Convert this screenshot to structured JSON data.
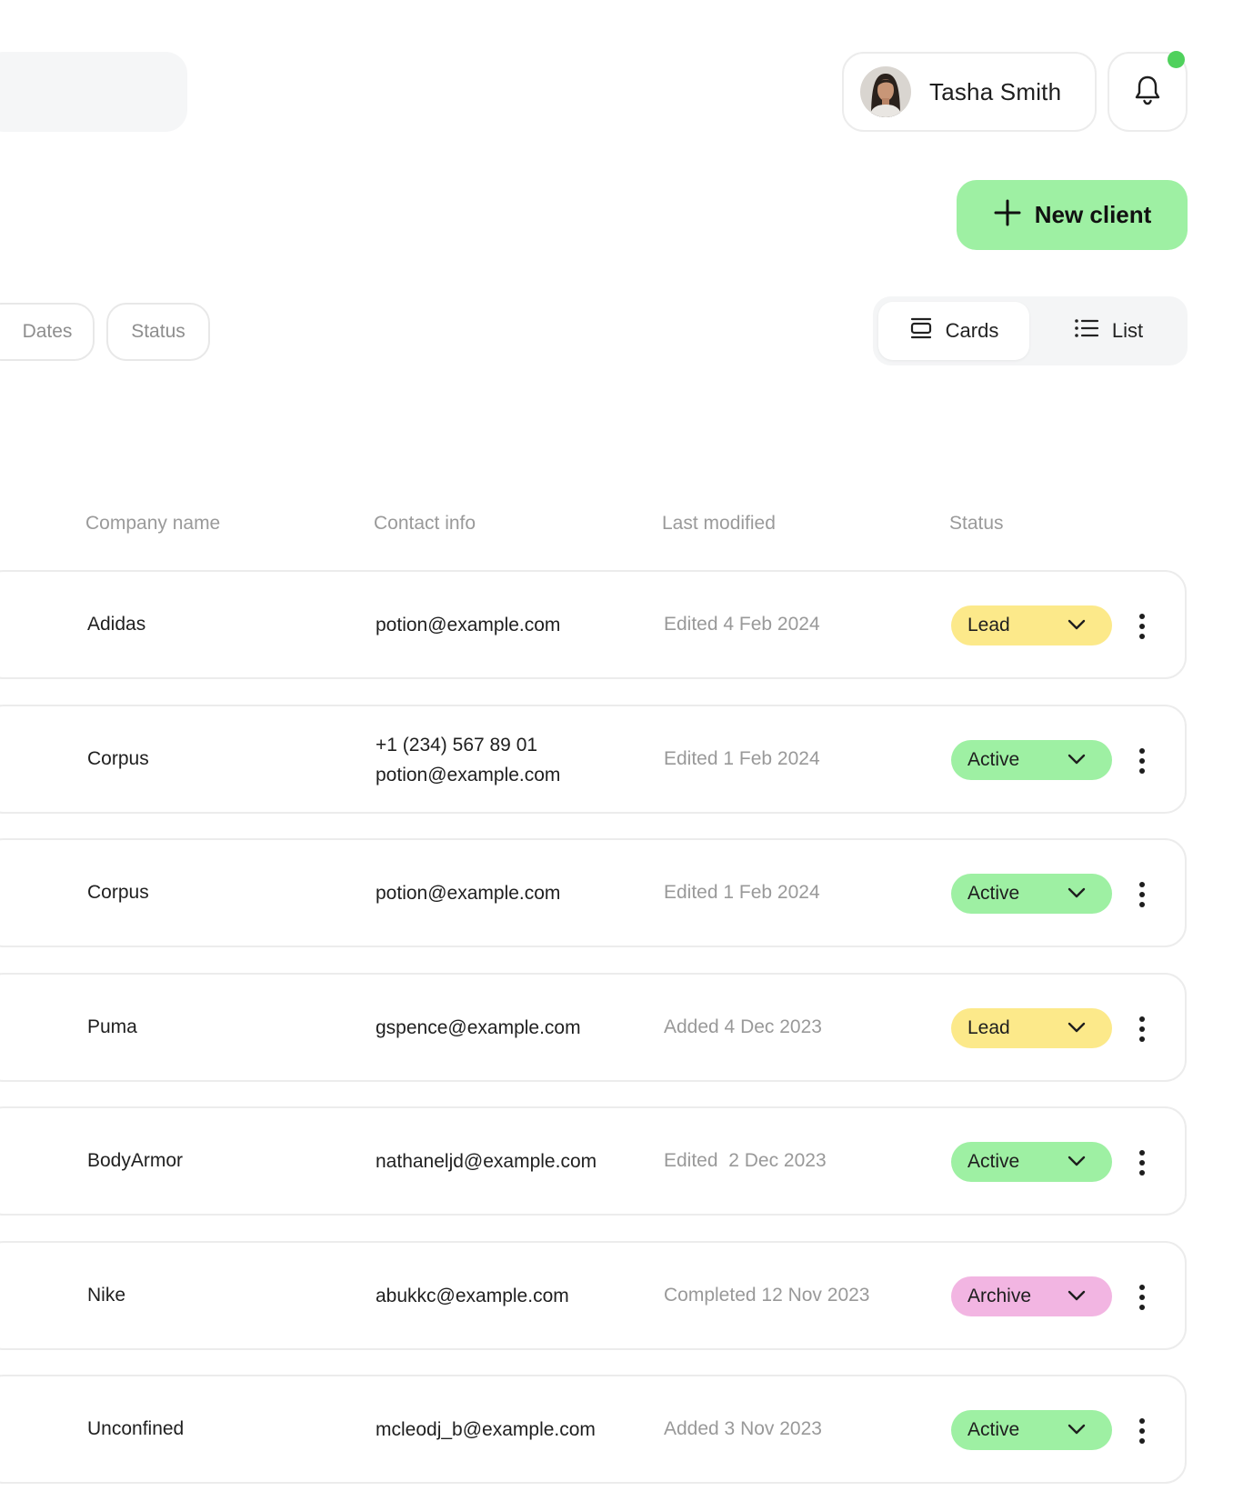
{
  "header": {
    "user": {
      "name": "Tasha Smith"
    },
    "new_client_label": "New client"
  },
  "filters": {
    "dates_label": "Dates",
    "status_label": "Status"
  },
  "view_toggle": {
    "cards_label": "Cards",
    "list_label": "List",
    "selected": "Cards"
  },
  "table": {
    "columns": [
      "Company name",
      "Contact info",
      "Last modified",
      "Status"
    ],
    "rows": [
      {
        "company": "Adidas",
        "contact": [
          "potion@example.com"
        ],
        "modified": "Edited 4 Feb 2024",
        "status": "Lead"
      },
      {
        "company": "Corpus",
        "contact": [
          "+1 (234) 567 89 01",
          "potion@example.com"
        ],
        "modified": "Edited 1 Feb 2024",
        "status": "Active"
      },
      {
        "company": "Corpus",
        "contact": [
          "potion@example.com"
        ],
        "modified": "Edited 1 Feb 2024",
        "status": "Active"
      },
      {
        "company": "Puma",
        "contact": [
          "gspence@example.com"
        ],
        "modified": "Added 4 Dec 2023",
        "status": "Lead"
      },
      {
        "company": "BodyArmor",
        "contact": [
          "nathaneljd@example.com"
        ],
        "modified": "Edited  2 Dec 2023",
        "status": "Active"
      },
      {
        "company": "Nike",
        "contact": [
          "abukkc@example.com"
        ],
        "modified": "Completed 12 Nov 2023",
        "status": "Archive"
      },
      {
        "company": "Unconfined",
        "contact": [
          "mcleodj_b@example.com"
        ],
        "modified": "Added 3 Nov 2023",
        "status": "Active"
      }
    ]
  },
  "status_colors": {
    "Lead": "#fce98a",
    "Active": "#9ef0a3",
    "Archive": "#f2b5e2"
  },
  "colors": {
    "accent": "#9ef0a3",
    "notification_dot": "#4fd15c"
  }
}
